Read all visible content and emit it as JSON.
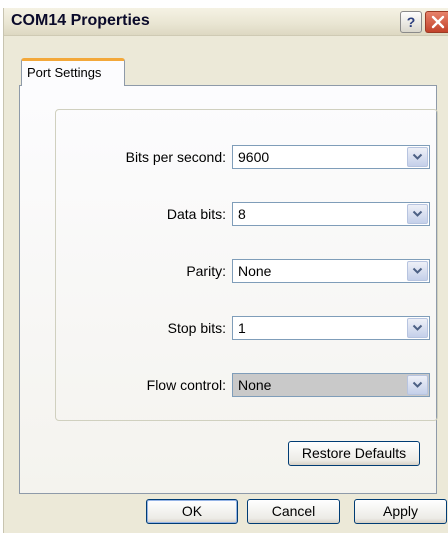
{
  "window": {
    "title": "COM14 Properties"
  },
  "titlebar": {
    "help_glyph": "?"
  },
  "tabs": [
    {
      "label": "Port Settings"
    }
  ],
  "fields": {
    "bits_per_second": {
      "label": "Bits per second:",
      "value": "9600"
    },
    "data_bits": {
      "label": "Data bits:",
      "value": "8"
    },
    "parity": {
      "label": "Parity:",
      "value": "None"
    },
    "stop_bits": {
      "label": "Stop bits:",
      "value": "1"
    },
    "flow_control": {
      "label": "Flow control:",
      "value": "None"
    }
  },
  "buttons": {
    "restore_defaults": "Restore Defaults",
    "ok": "OK",
    "cancel": "Cancel",
    "apply": "Apply"
  },
  "icons": {
    "help": "help-icon",
    "close": "close-icon",
    "dropdown": "chevron-down-icon"
  },
  "colors": {
    "tab_accent": "#f3a83a",
    "close_button": "#c2422a",
    "dialog_background": "#ece9d8"
  }
}
